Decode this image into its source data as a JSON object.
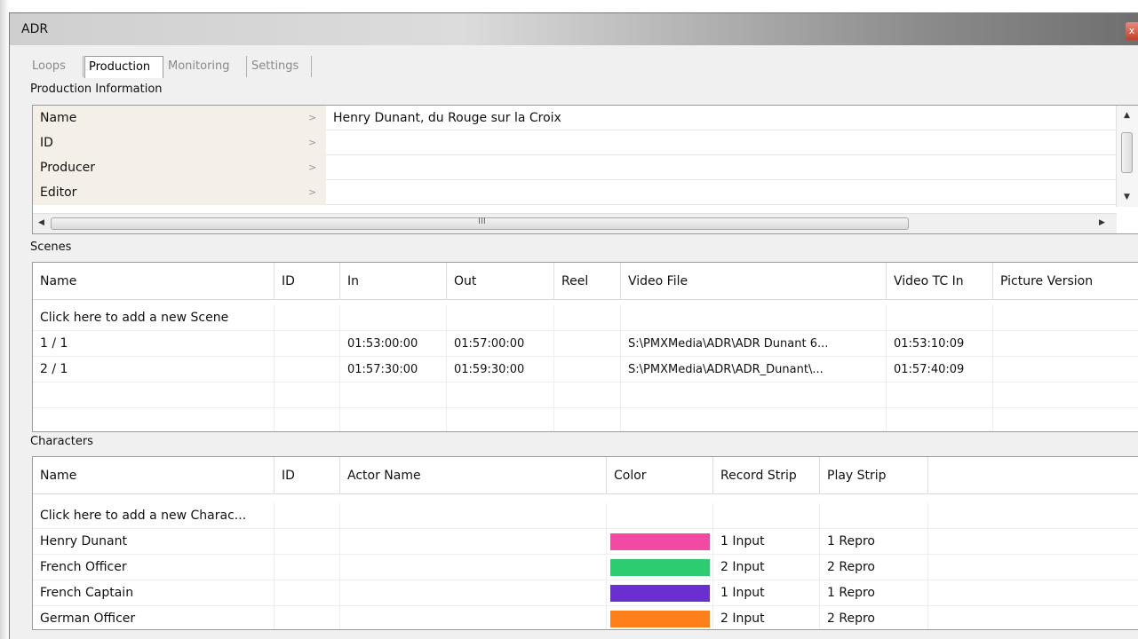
{
  "window": {
    "title": "ADR"
  },
  "tabs": [
    {
      "label": "Loops",
      "active": false
    },
    {
      "label": "Production",
      "active": true
    },
    {
      "label": "Monitoring",
      "active": false
    },
    {
      "label": "Settings",
      "active": false
    }
  ],
  "production": {
    "section_label": "Production Information",
    "rows": [
      {
        "label": "Name",
        "arrow": ">",
        "value": "Henry Dunant, du Rouge sur la Croix"
      },
      {
        "label": "ID",
        "arrow": ">",
        "value": ""
      },
      {
        "label": "Producer",
        "arrow": ">",
        "value": ""
      },
      {
        "label": "Editor",
        "arrow": ">",
        "value": ""
      }
    ],
    "hscroll_grip": "III"
  },
  "scenes": {
    "section_label": "Scenes",
    "columns": [
      "Name",
      "ID",
      "In",
      "Out",
      "Reel",
      "Video File",
      "Video TC In",
      "Picture Version"
    ],
    "add_row": "Click here to add a new Scene",
    "rows": [
      {
        "name": "1 / 1",
        "id": "",
        "in": "01:53:00:00",
        "out": "01:57:00:00",
        "reel": "",
        "video_file": "S:\\PMXMedia\\ADR\\ADR Dunant 6...",
        "video_tc_in": "01:53:10:09",
        "picture_version": ""
      },
      {
        "name": "2 / 1",
        "id": "",
        "in": "01:57:30:00",
        "out": "01:59:30:00",
        "reel": "",
        "video_file": "S:\\PMXMedia\\ADR\\ADR_Dunant\\...",
        "video_tc_in": "01:57:40:09",
        "picture_version": ""
      }
    ]
  },
  "characters": {
    "section_label": "Characters",
    "columns": [
      "Name",
      "ID",
      "Actor Name",
      "Color",
      "Record Strip",
      "Play Strip"
    ],
    "add_row": "Click here to add a new Charac...",
    "rows": [
      {
        "name": "Henry Dunant",
        "id": "",
        "actor": "",
        "color": "#f24aa3",
        "record_strip": "1 Input",
        "play_strip": "1 Repro"
      },
      {
        "name": "French Officer",
        "id": "",
        "actor": "",
        "color": "#2ecc71",
        "record_strip": "2 Input",
        "play_strip": "2 Repro"
      },
      {
        "name": "French Captain",
        "id": "",
        "actor": "",
        "color": "#6a2fd0",
        "record_strip": "1 Input",
        "play_strip": "1 Repro"
      },
      {
        "name": "German Officer",
        "id": "",
        "actor": "",
        "color": "#ff7f1a",
        "record_strip": "2 Input",
        "play_strip": "2 Repro"
      }
    ]
  },
  "icons": {
    "close": "close-icon",
    "scroll_up": "scroll-up-arrow-icon",
    "scroll_down": "scroll-down-arrow-icon",
    "scroll_left": "scroll-left-arrow-icon",
    "scroll_right": "scroll-right-arrow-icon"
  }
}
